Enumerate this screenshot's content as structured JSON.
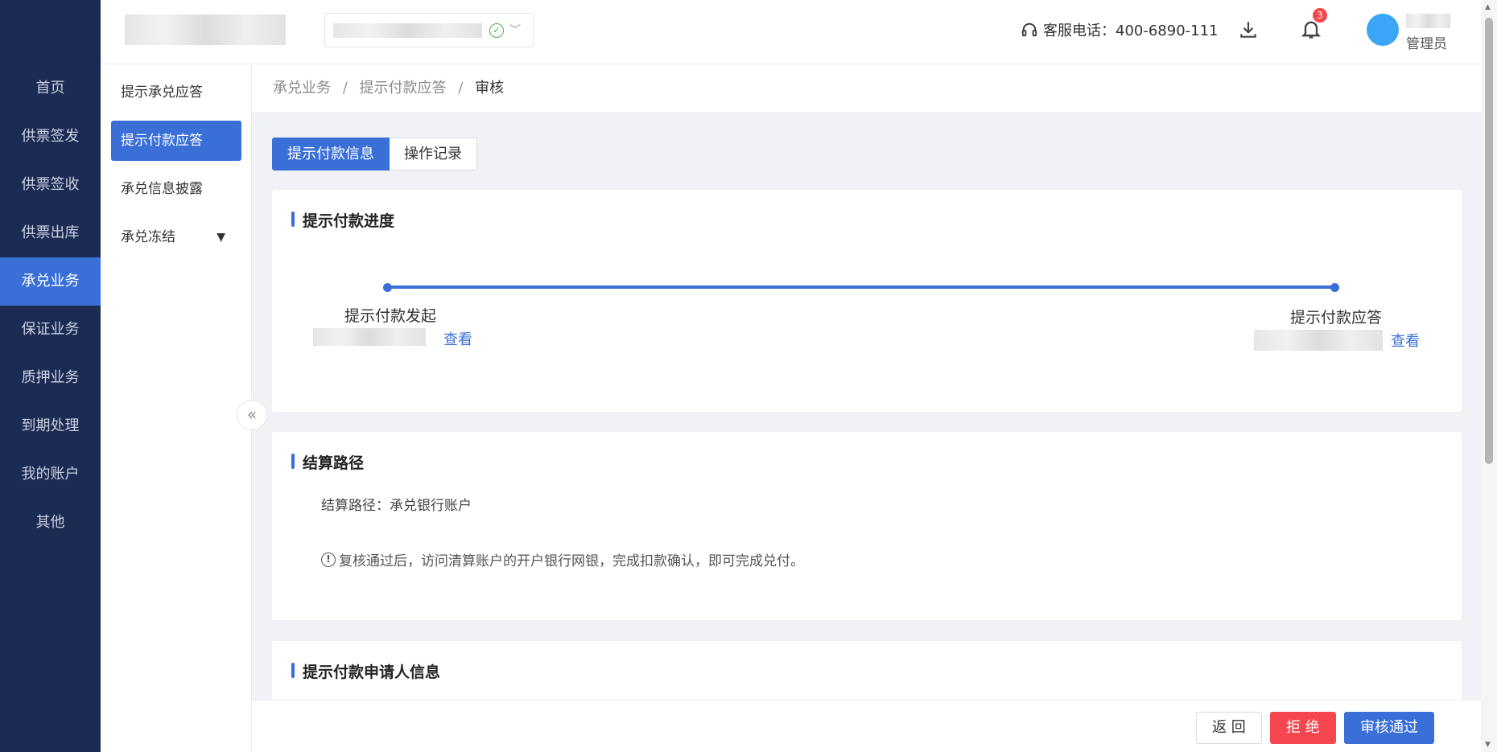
{
  "left_nav": {
    "items": [
      {
        "label": "首页"
      },
      {
        "label": "供票签发"
      },
      {
        "label": "供票签收"
      },
      {
        "label": "供票出库"
      },
      {
        "label": "承兑业务"
      },
      {
        "label": "保证业务"
      },
      {
        "label": "质押业务"
      },
      {
        "label": "到期处理"
      },
      {
        "label": "我的账户"
      },
      {
        "label": "其他"
      }
    ],
    "active": "承兑业务"
  },
  "header": {
    "hotline_label": "客服电话：400-6890-111",
    "notification_count": "3",
    "user_role": "管理员"
  },
  "sub_nav": {
    "items": [
      {
        "label": "提示承兑应答"
      },
      {
        "label": "提示付款应答"
      },
      {
        "label": "承兑信息披露"
      },
      {
        "label": "承兑冻结"
      }
    ],
    "active": "提示付款应答"
  },
  "breadcrumb": {
    "items": [
      "承兑业务",
      "提示付款应答"
    ],
    "current": "审核",
    "separator": "/"
  },
  "tabs": [
    {
      "label": "提示付款信息"
    },
    {
      "label": "操作记录"
    }
  ],
  "progress_card": {
    "title": "提示付款进度",
    "steps": [
      {
        "label": "提示付款发起",
        "link": "查看"
      },
      {
        "label": "提示付款应答",
        "link": "查看"
      }
    ]
  },
  "settlement_card": {
    "title": "结算路径",
    "path_line": "结算路径：承兑银行账户",
    "notice": "复核通过后，访问清算账户的开户银行网银，完成扣款确认，即可完成兑付。"
  },
  "applicant_card": {
    "title": "提示付款申请人信息"
  },
  "footer": {
    "back_label": "返 回",
    "reject_label": "拒 绝",
    "approve_label": "审核通过"
  },
  "colors": {
    "sidebar_bg": "#1c2b52",
    "primary": "#3a6fd8",
    "danger": "#f5454f",
    "avatar": "#3ba6f5",
    "success": "#4caf50"
  },
  "icons": [
    "check-circle-icon",
    "chevron-down-icon",
    "headset-icon",
    "download-icon",
    "bell-icon",
    "info-icon",
    "double-chevron-left-icon"
  ]
}
